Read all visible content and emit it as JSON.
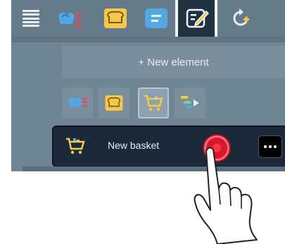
{
  "toolbar": {
    "icons": [
      "menu-icon",
      "cooking-tab-icon",
      "bread-tab-icon",
      "list-tab-icon",
      "edit-tab-icon",
      "add-refresh-icon"
    ],
    "active_icon": "edit-tab-icon"
  },
  "new_element_label": "+ New element",
  "filter_chips": [
    {
      "icon": "cooking-chip-icon",
      "selected": false
    },
    {
      "icon": "bread-chip-icon",
      "selected": false
    },
    {
      "icon": "basket-chip-icon",
      "selected": true
    },
    {
      "icon": "sequence-chip-icon",
      "selected": false
    }
  ],
  "list_row": {
    "icon": "basket-icon",
    "label": "New basket",
    "more_icon": "more-options-icon"
  },
  "colors": {
    "background": "#6f8594",
    "topbar": "#667b89",
    "row": "#1b2a38",
    "tap_highlight": "#d7192b",
    "accent_yellow": "#f2c94c",
    "accent_blue": "#53a7e3"
  }
}
